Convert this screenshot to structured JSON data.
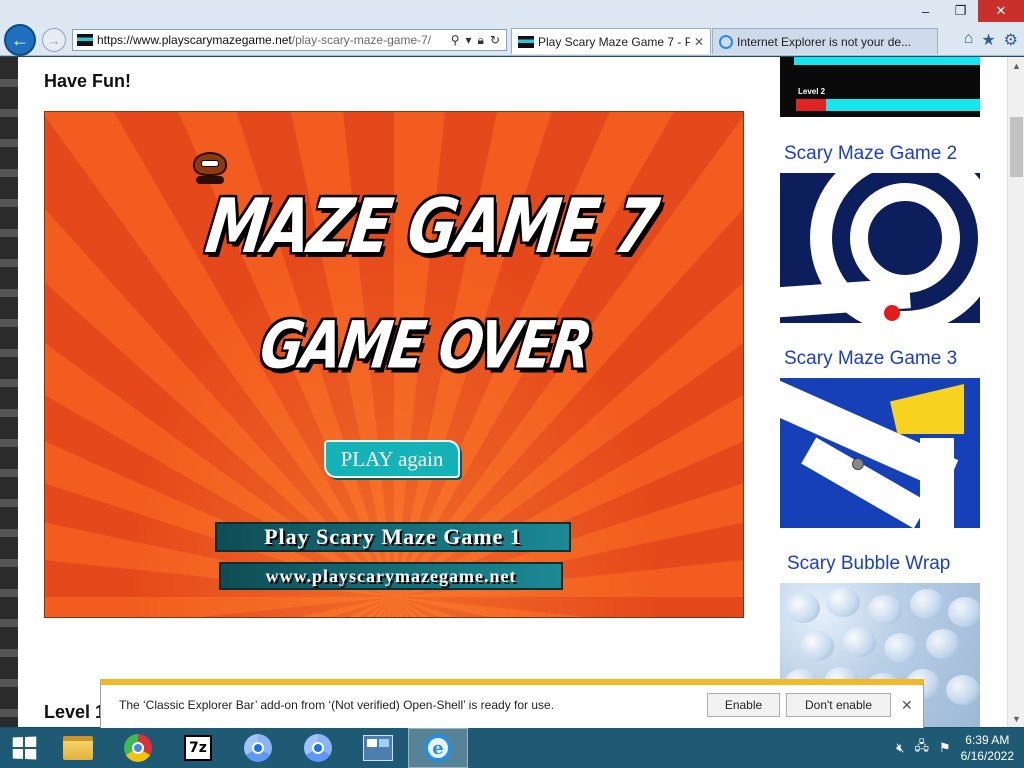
{
  "browser": {
    "url_host": "https://www.playscarymazegame.net",
    "url_path": "/play-scary-maze-game-7/",
    "tabs": [
      {
        "label": "Play Scary Maze Game 7 - P...",
        "active": true
      },
      {
        "label": "Internet Explorer is not your de...",
        "active": false
      }
    ],
    "window_controls": {
      "minimize": "–",
      "restore": "❐",
      "close": "✕"
    }
  },
  "page": {
    "heading": "Have Fun!",
    "level_heading": "Level 1",
    "game": {
      "title": "MAZE GAME 7",
      "subtitle": "GAME OVER",
      "play_again": "PLAY again",
      "link1": "Play Scary Maze Game 1",
      "link2": "www.playscarymazegame.net"
    },
    "sidebar": {
      "top_thumb_label": "Level 2",
      "links": [
        "Scary Maze Game 2",
        "Scary Maze Game 3",
        "Scary Bubble Wrap"
      ]
    }
  },
  "notification": {
    "message": "The ‘Classic Explorer Bar’ add-on from ‘(Not verified) Open-Shell’ is ready for use.",
    "enable": "Enable",
    "dont_enable": "Don't enable",
    "close": "✕"
  },
  "taskbar": {
    "time": "6:39 AM",
    "date": "6/16/2022"
  },
  "colors": {
    "game_orange": "#f25c1e",
    "link_blue": "#1a3ec9",
    "notify_accent": "#f2ba2a",
    "taskbar": "#1f5a75"
  }
}
